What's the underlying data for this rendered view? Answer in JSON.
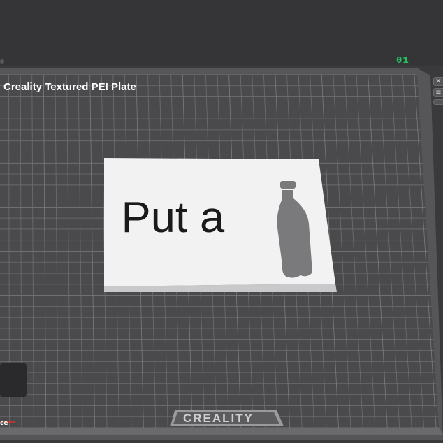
{
  "plate": {
    "name": "Creality Textured PEI Plate",
    "number": "01",
    "brand": "CREALITY"
  },
  "model": {
    "text": "Put a",
    "icon": "bottle-icon"
  },
  "side_controls": {
    "close_glyph": "✕",
    "icon": "plate-settings-icon"
  },
  "left_panel": {
    "fragment": "ce"
  },
  "colors": {
    "background": "#3a3a3c",
    "bed": "#4a4a4d",
    "grid_line": "#6e6e71",
    "model_white": "#f2f2f2",
    "model_black": "#1a1a1a",
    "bottle_gray": "#7a7a7c",
    "plate_number_green": "#22c55e",
    "axis_red": "#c0392b"
  }
}
